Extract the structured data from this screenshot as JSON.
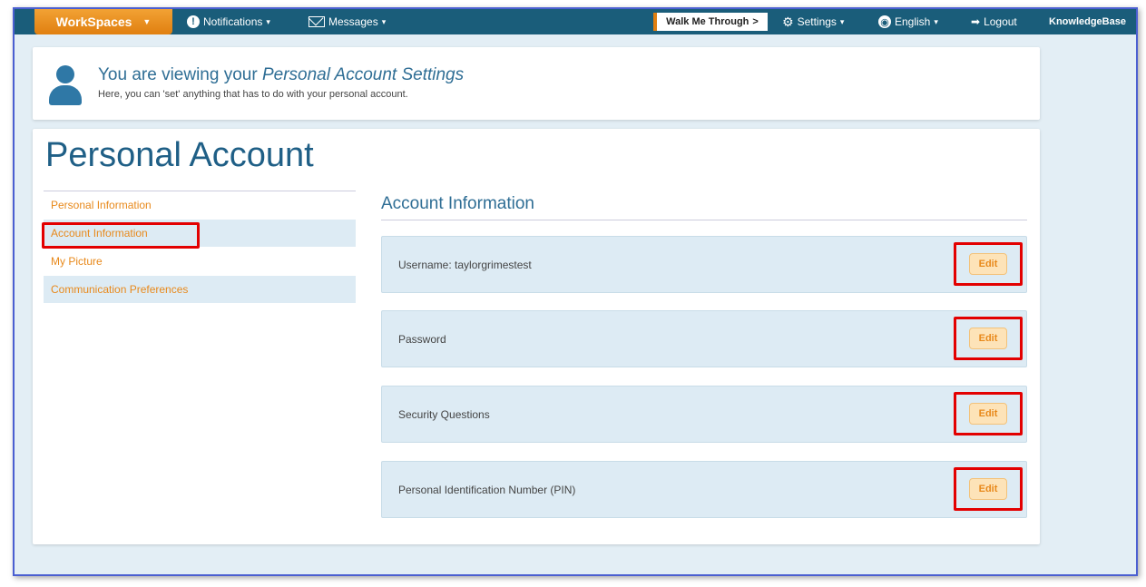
{
  "topnav": {
    "workspaces_label": "WorkSpaces",
    "notifications_label": "Notifications",
    "messages_label": "Messages",
    "walk_label": "Walk Me Through",
    "walk_arrow": ">",
    "settings_label": "Settings",
    "english_label": "English",
    "logout_label": "Logout",
    "knowledgebase_label": "KnowledgeBase"
  },
  "header": {
    "title_prefix": "You are viewing your",
    "title_emphasis": "Personal Account Settings",
    "subtitle": "Here, you can 'set' anything that has to do with your personal account."
  },
  "page": {
    "title": "Personal Account"
  },
  "sidebar": {
    "items": [
      {
        "label": "Personal Information"
      },
      {
        "label": "Account Information"
      },
      {
        "label": "My Picture"
      },
      {
        "label": "Communication Preferences"
      }
    ]
  },
  "account": {
    "title": "Account Information",
    "rows": [
      {
        "label": "Username: taylorgrimestest",
        "edit": "Edit"
      },
      {
        "label": "Password",
        "edit": "Edit"
      },
      {
        "label": "Security Questions",
        "edit": "Edit"
      },
      {
        "label": "Personal Identification Number (PIN)",
        "edit": "Edit"
      }
    ]
  },
  "colors": {
    "nav_bg": "#1a5d7a",
    "accent_orange": "#e8891b",
    "highlight_red": "#e30000",
    "title_blue": "#1f5f86",
    "row_bg": "#ddebf4"
  }
}
